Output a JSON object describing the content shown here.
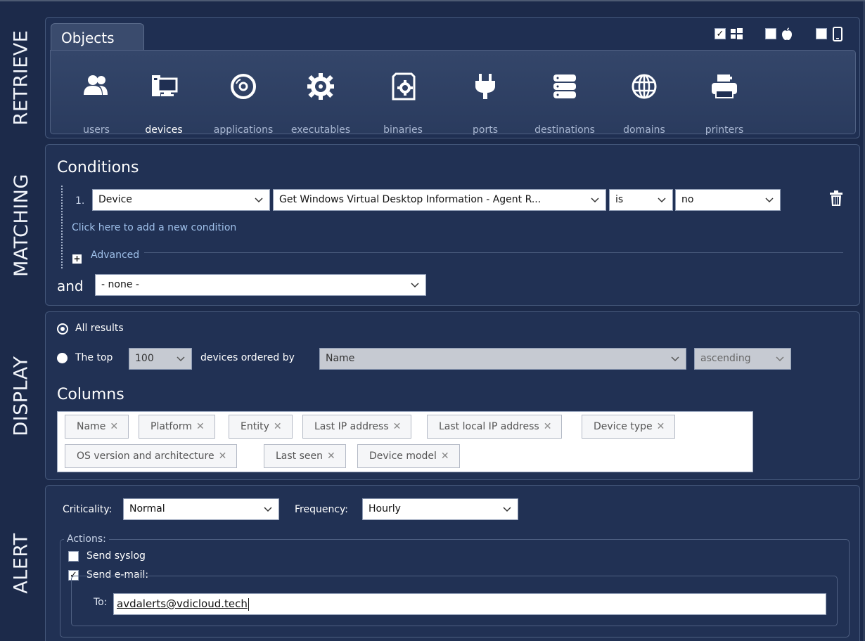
{
  "retrieve": {
    "section_label": "RETRIEVE",
    "tab_label": "Objects",
    "platforms": [
      {
        "name": "windows-icon",
        "checked": true
      },
      {
        "name": "apple-icon",
        "checked": false
      },
      {
        "name": "mobile-icon",
        "checked": false
      }
    ],
    "objects": [
      {
        "label": "users",
        "icon": "users-icon",
        "active": false
      },
      {
        "label": "devices",
        "icon": "devices-icon",
        "active": true
      },
      {
        "label": "applications",
        "icon": "applications-icon",
        "active": false
      },
      {
        "label": "executables",
        "icon": "executables-icon",
        "active": false
      },
      {
        "label": "binaries",
        "icon": "binaries-icon",
        "active": false
      },
      {
        "label": "ports",
        "icon": "ports-icon",
        "active": false
      },
      {
        "label": "destinations",
        "icon": "destinations-icon",
        "active": false
      },
      {
        "label": "domains",
        "icon": "domains-icon",
        "active": false
      },
      {
        "label": "printers",
        "icon": "printers-icon",
        "active": false
      }
    ]
  },
  "matching": {
    "section_label": "MATCHING",
    "title": "Conditions",
    "condition": {
      "number": "1.",
      "object": "Device",
      "property": "Get Windows Virtual Desktop Information - Agent R...",
      "operator": "is",
      "value": "no"
    },
    "add_condition_link": "Click here to add a new condition",
    "advanced_label": "Advanced",
    "and_label": "and",
    "and_value": "- none -"
  },
  "display": {
    "section_label": "DISPLAY",
    "all_results_label": "All results",
    "top_label": "The top",
    "top_value": "100",
    "ordered_by_label": "devices ordered by",
    "ordered_by_value": "Name",
    "order_direction": "ascending",
    "columns_title": "Columns",
    "columns": [
      "Name",
      "Platform",
      "Entity",
      "Last IP address",
      "Last local IP address",
      "Device type",
      "OS version and architecture",
      "Last seen",
      "Device model"
    ]
  },
  "alert": {
    "section_label": "ALERT",
    "criticality_label": "Criticality:",
    "criticality_value": "Normal",
    "frequency_label": "Frequency:",
    "frequency_value": "Hourly",
    "actions_label": "Actions:",
    "send_syslog_label": "Send syslog",
    "send_syslog_checked": false,
    "send_email_label": "Send e-mail:",
    "send_email_checked": true,
    "to_label": "To:",
    "to_value": "avdalerts@vdicloud.tech"
  },
  "colors": {
    "background": "#1c2a4a",
    "panel": "#213154",
    "link": "#9fc0ea",
    "text": "#ffffff"
  }
}
